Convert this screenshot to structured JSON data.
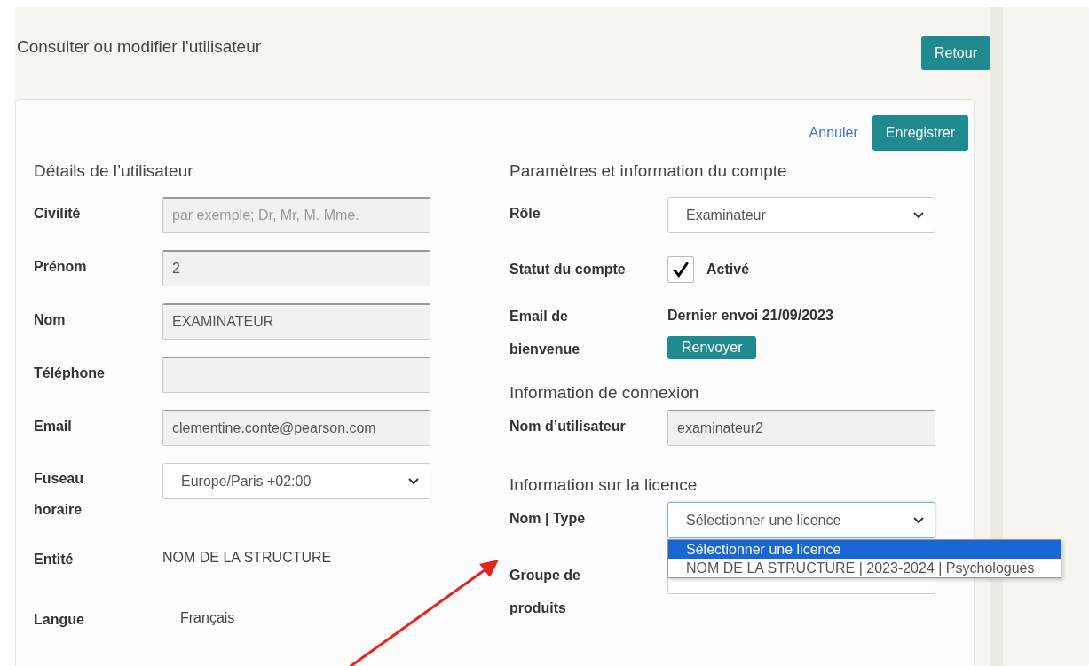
{
  "page": {
    "title": "Consulter ou modifier l'utilisateur",
    "back_button": "Retour"
  },
  "actions": {
    "cancel": "Annuler",
    "save": "Enregistrer"
  },
  "user_details": {
    "heading": "Détails de l’utilisateur",
    "fields": [
      {
        "kind": "input",
        "label": "Civilité",
        "placeholder": "par exemple; Dr, Mr, M. Mme."
      },
      {
        "kind": "input",
        "label": "Prénom",
        "value": "2"
      },
      {
        "kind": "input",
        "label": "Nom",
        "value": "EXAMINATEUR"
      },
      {
        "kind": "input",
        "label": "Téléphone"
      },
      {
        "kind": "input",
        "label": "Email",
        "value": "clementine.conte@pearson.com"
      },
      {
        "kind": "select",
        "label": "Fuseau horaire",
        "value": "Europe/Paris +02:00"
      },
      {
        "kind": "text",
        "label": "Entité",
        "value": "NOM DE LA STRUCTURE"
      },
      {
        "kind": "text",
        "label": "Langue",
        "value": "Français"
      }
    ]
  },
  "account": {
    "heading": "Paramètres et information du compte",
    "role": {
      "label": "Rôle",
      "value": "Examinateur"
    },
    "status": {
      "label": "Statut du compte",
      "checked": true,
      "text": "Activé"
    },
    "welcome_email": {
      "label": "Email de bienvenue",
      "last_sent": "Dernier envoi 21/09/2023",
      "button": "Renvoyer"
    }
  },
  "connection": {
    "heading": "Information de connexion",
    "username": {
      "label": "Nom d’utilisateur",
      "value": "examinateur2"
    }
  },
  "licence": {
    "heading": "Information sur la licence",
    "name_type": {
      "label": "Nom | Type",
      "value": "Sélectionner une licence",
      "expanded": true,
      "options": [
        {
          "label": "Sélectionner une licence",
          "selected": true
        },
        {
          "label": "NOM DE LA STRUCTURE | 2023-2024 | Psychologues",
          "selected": false
        }
      ]
    },
    "product_group": {
      "label": "Groupe de produits"
    }
  }
}
